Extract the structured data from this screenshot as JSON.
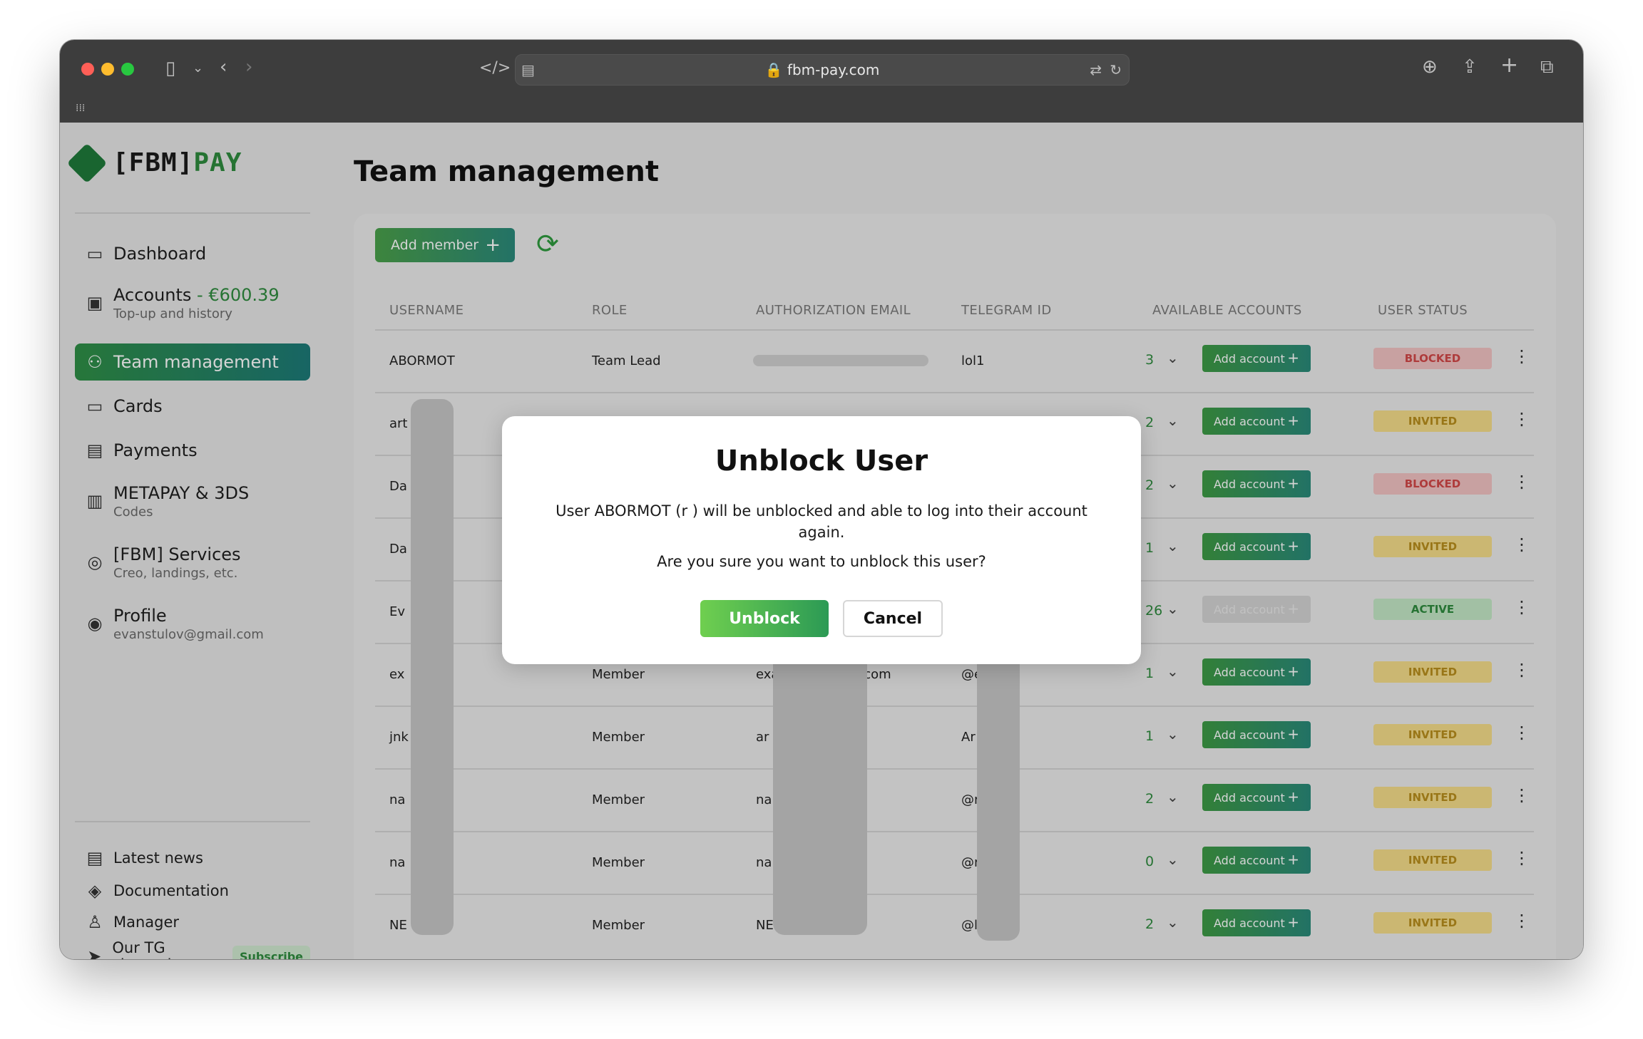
{
  "browser": {
    "url": "fbm-pay.com"
  },
  "logo": {
    "brand": "[FBM]",
    "accent": "PAY"
  },
  "sidebar": {
    "items": [
      {
        "label": "Dashboard",
        "icon": "monitor-icon"
      },
      {
        "label": "Accounts",
        "balance": "- €600.39",
        "sub": "Top-up and history",
        "icon": "wallet-icon"
      },
      {
        "label": "Team management",
        "icon": "team-icon"
      },
      {
        "label": "Cards",
        "icon": "card-icon"
      },
      {
        "label": "Payments",
        "icon": "receipt-icon"
      },
      {
        "label": "METAPAY & 3DS",
        "sub": "Codes",
        "icon": "barcode-icon"
      },
      {
        "label": "[FBM] Services",
        "sub": "Creo, landings, etc.",
        "icon": "services-icon"
      },
      {
        "label": "Profile",
        "sub": "evanstulov@gmail.com",
        "icon": "profile-icon"
      }
    ],
    "footer": [
      {
        "label": "Latest news",
        "icon": "news-icon"
      },
      {
        "label": "Documentation",
        "icon": "layers-icon"
      },
      {
        "label": "Manager",
        "icon": "person-icon"
      },
      {
        "label": "Our TG channel",
        "icon": "send-icon",
        "badge": "Subscribe"
      }
    ]
  },
  "main": {
    "title": "Team management",
    "add_member_label": "Add member",
    "add_member_plus": "+",
    "columns": [
      "USERNAME",
      "ROLE",
      "AUTHORIZATION EMAIL",
      "TELEGRAM ID",
      "AVAILABLE ACCOUNTS",
      "USER STATUS"
    ],
    "add_account_label": "Add account",
    "add_account_plus": "+",
    "rows": [
      {
        "username": "ABORMOT",
        "role": "Team Lead",
        "email": "",
        "telegram": "lol1",
        "accounts": "3",
        "status": "BLOCKED"
      },
      {
        "username": "art      T",
        "role": "",
        "email": "",
        "telegram": "",
        "accounts": "2",
        "status": "INVITED"
      },
      {
        "username": "Da        kov",
        "role": "",
        "email": "",
        "telegram": "",
        "accounts": "2",
        "status": "BLOCKED"
      },
      {
        "username": "Da",
        "role": "",
        "email": "",
        "telegram": "",
        "accounts": "1",
        "status": "INVITED"
      },
      {
        "username": "Ev",
        "role": "",
        "email": "",
        "telegram": "",
        "accounts": "26",
        "status": "ACTIVE"
      },
      {
        "username": "ex",
        "role": "Member",
        "email": "example@gmail.com",
        "telegram": "@e     le",
        "accounts": "1",
        "status": "INVITED"
      },
      {
        "username": "jnk       dns",
        "role": "Member",
        "email": "ar                lasd.ru",
        "telegram": "Ar        t 2.0",
        "accounts": "1",
        "status": "INVITED"
      },
      {
        "username": "na",
        "role": "Member",
        "email": "na",
        "telegram": "@r",
        "accounts": "2",
        "status": "INVITED"
      },
      {
        "username": "na",
        "role": "Member",
        "email": "na                 n",
        "telegram": "@r",
        "accounts": "0",
        "status": "INVITED"
      },
      {
        "username": "NE      .E",
        "role": "Member",
        "email": "NE                .com",
        "telegram": "@l        ME",
        "accounts": "2",
        "status": "INVITED"
      }
    ]
  },
  "modal": {
    "title": "Unblock User",
    "message": "User ABORMOT (r          ) will be unblocked and able to log into their account again.",
    "question": "Are you sure you want to unblock this user?",
    "confirm_label": "Unblock",
    "cancel_label": "Cancel"
  },
  "colors": {
    "accent_green": "#2e8b3e",
    "blocked": "#d24848",
    "invited": "#b98f1c",
    "active": "#2e8b3e"
  }
}
